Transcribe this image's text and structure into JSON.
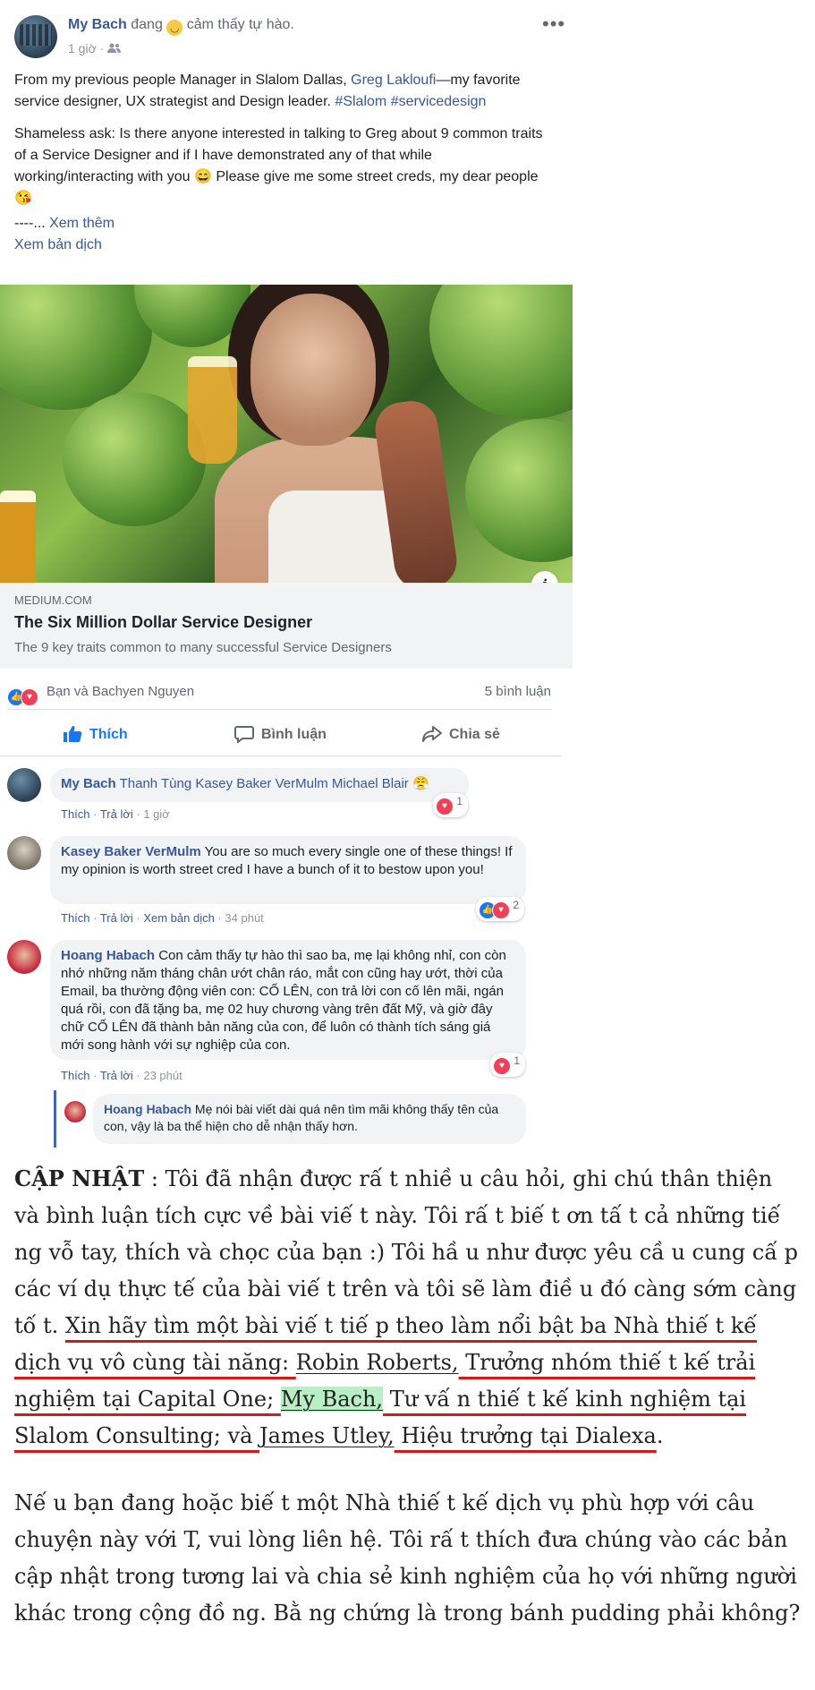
{
  "post": {
    "author": "My Bach",
    "status_prefix": "đang",
    "status_suffix": "cảm thấy tự hào.",
    "time": "1 giờ",
    "text_p1_part1": "From my previous people Manager in Slalom Dallas, ",
    "text_p1_link1": "Greg Lakloufi",
    "text_p1_part2": "—my favorite service designer, UX strategist and Design leader. ",
    "text_p1_tag1": "#Slalom",
    "text_p1_tag2": "#servicedesign",
    "text_p2": "Shameless ask: Is there anyone interested in talking to Greg about 9 common traits of a Service Designer and if I have demonstrated any of that while working/interacting with you 😄 Please give me some street creds, my dear people 😘",
    "text_more_prefix": "----... ",
    "see_more": "Xem thêm",
    "see_translation": "Xem bản dịch"
  },
  "link_preview": {
    "domain": "MEDIUM.COM",
    "title": "The Six Million Dollar Service Designer",
    "description": "The 9 key traits common to many successful Service Designers"
  },
  "reactions": {
    "names": "Bạn và Bachyen Nguyen",
    "comment_count": "5 bình luận"
  },
  "actions": {
    "like": "Thích",
    "comment": "Bình luận",
    "share": "Chia sẻ"
  },
  "comments": [
    {
      "name": "My Bach",
      "text": "Thanh Tùng Kasey Baker VerMulm Michael Blair 😤",
      "like": "Thích",
      "reply": "Trả lời",
      "time": "1 giờ",
      "reaction_count": "1"
    },
    {
      "name": "Kasey Baker VerMulm",
      "text": "You are so much every single one of these things! If my opinion is worth street cred I have a bunch of it to bestow upon you!",
      "like": "Thích",
      "reply": "Trả lời",
      "translate": "Xem bản dịch",
      "time": "34 phút",
      "reaction_count": "2"
    },
    {
      "name": "Hoang Habach",
      "text": "Con cảm thấy tự hào thì sao ba, mẹ lại không nhỉ, con còn nhớ những năm tháng chân ướt chân ráo, mắt con cũng hay ướt, thời của Email, ba thường động viên con: CỐ LÊN, con trả lời con cố lên mãi, ngán quá rồi, con đã tặng ba, mẹ 02 huy chương vàng trên đất Mỹ, và giờ đây chữ CỐ LÊN đã thành bản năng của con, để luôn có thành tích sáng giá mới song hành với sự nghiệp của con.",
      "like": "Thích",
      "reply": "Trả lời",
      "time": "23 phút",
      "reaction_count": "1"
    },
    {
      "name": "Hoang Habach",
      "text": "Mẹ nói bài viết dài quá nên tìm mãi không thấy tên của con, vậy là ba thể hiện cho dễ nhận thấy hơn."
    }
  ],
  "article": {
    "update_label": "CẬP NHẬT",
    "p1_part1": " : Tôi đã nhận được rấ t nhiề u câu hỏi, ghi chú thân thiện và bình luận tích cực về  bài viế t này. Tôi rấ t biế t ơn tấ t cả những tiế ng vỗ tay, thích và chọc của bạn :) Tôi hầ u như được yêu cầ u cung cấ p các ví dụ thực tế  của bài viế t trên và tôi sẽ làm điề u đó càng sớm càng tố t. ",
    "p1_red1": "Xin hãy tìm một bài viế t tiế p theo làm nổi bật ba Nhà thiế t kế  dịch vụ vô cùng tài năng: ",
    "p1_name1": "Robin Roberts,",
    "p1_red2": " Trưởng nhóm thiế t kế  trải nghiệm tại Capital One; ",
    "p1_name2": "My Bach,",
    "p1_red3": " Tư vấ n thiế t kế  kinh nghiệm tại Slalom Consulting; và ",
    "p1_name3": "James Utley,",
    "p1_red4": " Hiệu trưởng tại Dialexa",
    "p1_end": ".",
    "p2": "Nế u bạn đang hoặc biế t một Nhà thiế t kế  dịch vụ phù hợp với câu chuyện này với T, vui lòng liên hệ. Tôi rấ t thích đưa chúng vào các bản cập nhật trong tương lai và chia sẻ kinh nghiệm của họ với những người khác trong cộng đồ ng. Bằ ng chứng là trong bánh pudding phải không?"
  }
}
